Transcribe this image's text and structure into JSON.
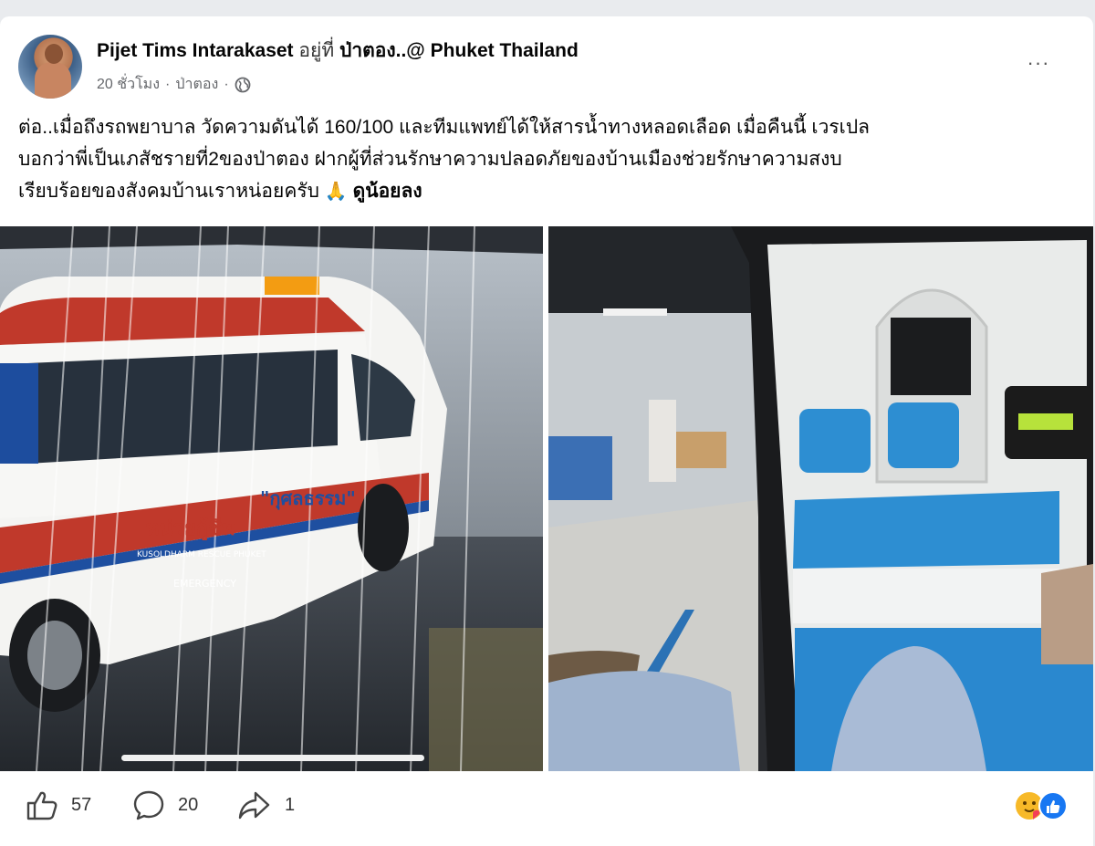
{
  "author": {
    "name": "Pijet Tims Intarakaset",
    "at_label": "อยู่ที่",
    "place": "ป่าตอง..@ Phuket Thailand"
  },
  "meta": {
    "time": "20 ชั่วโมง",
    "separator": "·",
    "location": "ป่าตอง",
    "privacy_icon": "globe-icon"
  },
  "more_label": "···",
  "post": {
    "line1": "ต่อ..เมื่อถึงรถพยาบาล วัดความดันได้ 160/100 และทีมแพทย์ได้ให้สารน้ำทางหลอดเลือด เมื่อคืนนี้ เวรเปล",
    "line2": "บอกว่าพี่เป็นเภสัชรายที่2ของป่าตอง ฝากผู้ที่ส่วนรักษาความปลอดภัยของบ้านเมืองช่วยรักษาความสงบ",
    "line3": "เรียบร้อยของสังคมบ้านเราหน่อยครับ",
    "emoji": "🙏",
    "see_less": "ดูน้อยลง"
  },
  "photos": {
    "left_text_1": "หน่วยกู้ชีพ",
    "left_text_2": "\"กุศลธรรม\"",
    "left_text_3": "KUSOLDHARM RESCUE PHUKET",
    "left_text_4": "EMERGENCY"
  },
  "actions": {
    "like_count": "57",
    "comment_count": "20",
    "share_count": "1"
  },
  "colors": {
    "accent_blue": "#1877f2",
    "reaction_yellow": "#f7b928"
  }
}
